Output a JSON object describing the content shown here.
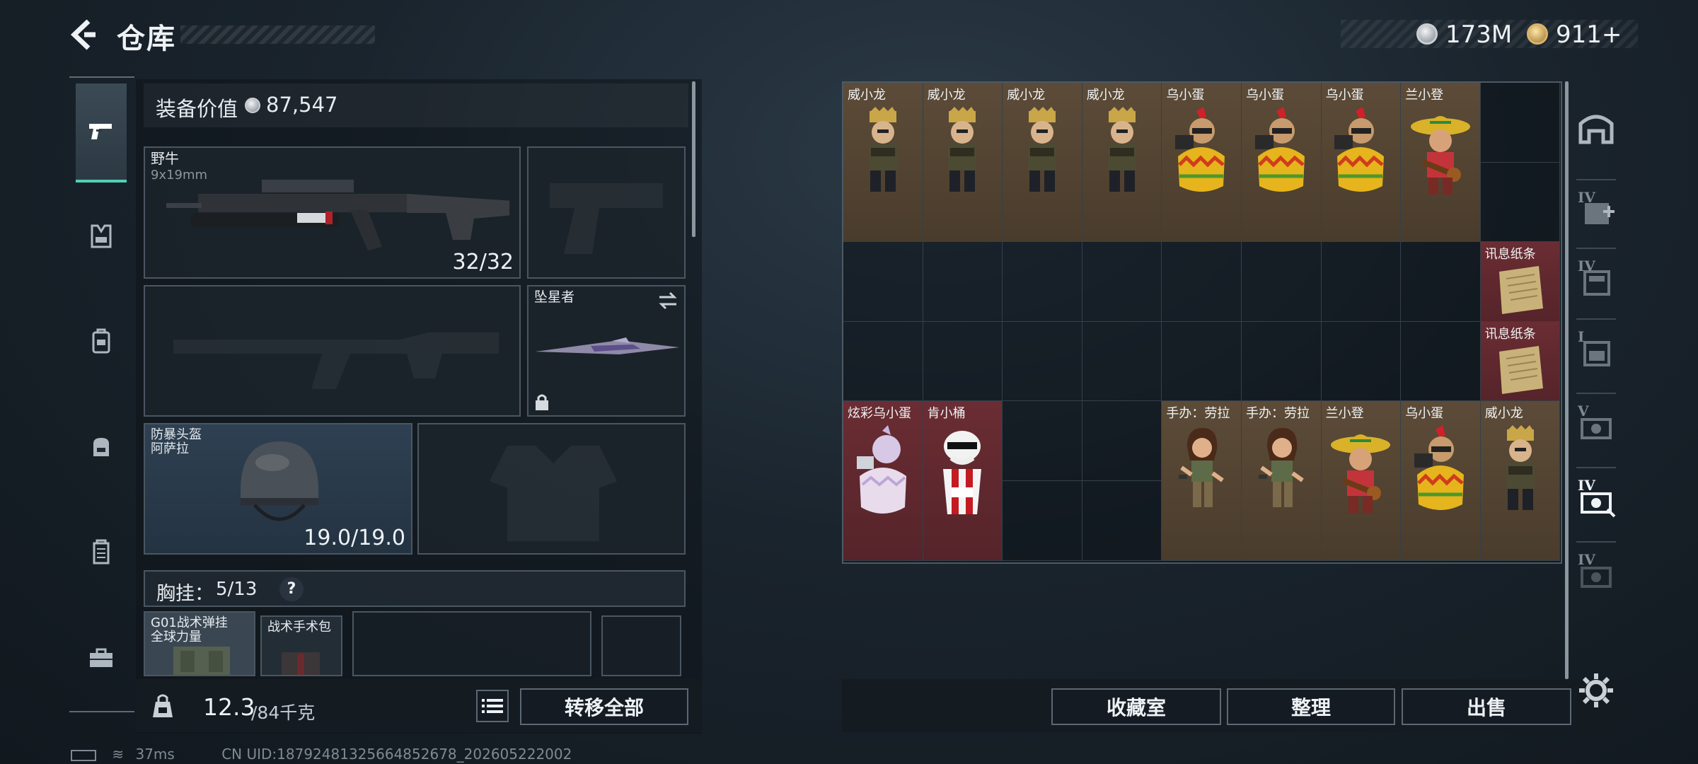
{
  "header": {
    "title": "仓库"
  },
  "currency": [
    {
      "value": "173M",
      "icon": "silver-coin-icon",
      "color": "#c9ced4"
    },
    {
      "value": "911+",
      "icon": "gold-coin-icon",
      "color": "#d9b36a"
    }
  ],
  "left_nav": [
    {
      "name": "weapon",
      "icon": "pistol-icon",
      "active": true
    },
    {
      "name": "armor",
      "icon": "vest-icon"
    },
    {
      "name": "helmet-bag",
      "icon": "rig-icon"
    },
    {
      "name": "backpack",
      "icon": "backpack-icon"
    },
    {
      "name": "case",
      "icon": "case-icon"
    },
    {
      "name": "toolbox",
      "icon": "toolbox-icon"
    }
  ],
  "loadout": {
    "equip_value_label": "装备价值",
    "equip_value": "87,547",
    "primary_weapon": {
      "name": "野牛",
      "caliber": "9x19mm",
      "ammo": "32/32"
    },
    "melee": {
      "name": "坠星者"
    },
    "helmet": {
      "name_line1": "防暴头盔",
      "name_line2": "阿萨拉",
      "durability": "19.0/19.0"
    },
    "chest_rig": {
      "label": "胸挂：",
      "capacity": "5/13",
      "help": "?"
    },
    "rig_items": [
      {
        "name_line1": "G01战术弹挂",
        "name_line2": "全球力量"
      },
      {
        "name": "战术手术包"
      }
    ],
    "weight": {
      "current": "12.3",
      "max": "/84千克"
    },
    "transfer_all": "转移全部"
  },
  "stash": {
    "row1": [
      "威小龙",
      "威小龙",
      "威小龙",
      "威小龙",
      "乌小蛋",
      "乌小蛋",
      "乌小蛋",
      "兰小登"
    ],
    "notes": [
      "讯息纸条",
      "讯息纸条"
    ],
    "row4": [
      "炫彩乌小蛋",
      "肯小桶",
      "",
      "",
      "手办：劳拉",
      "手办：劳拉",
      "兰小登",
      "乌小蛋",
      "威小龙"
    ]
  },
  "buttons": {
    "collection": "收藏室",
    "organize": "整理",
    "sell": "出售"
  },
  "right_nav": [
    {
      "icon": "shelter-icon",
      "label": ""
    },
    {
      "icon": "stash-add-icon",
      "label": "IV"
    },
    {
      "icon": "stash-page-icon",
      "label": "IV"
    },
    {
      "icon": "stash-page-2-icon",
      "label": "I"
    },
    {
      "icon": "stash-page-3-icon",
      "label": "V"
    },
    {
      "icon": "stash-page-4-icon",
      "label": "IV"
    },
    {
      "icon": "stash-page-5-icon",
      "label": "IV"
    }
  ],
  "status": {
    "ping": "37ms",
    "uid": "CN UID:18792481325664852678_202605222002"
  }
}
